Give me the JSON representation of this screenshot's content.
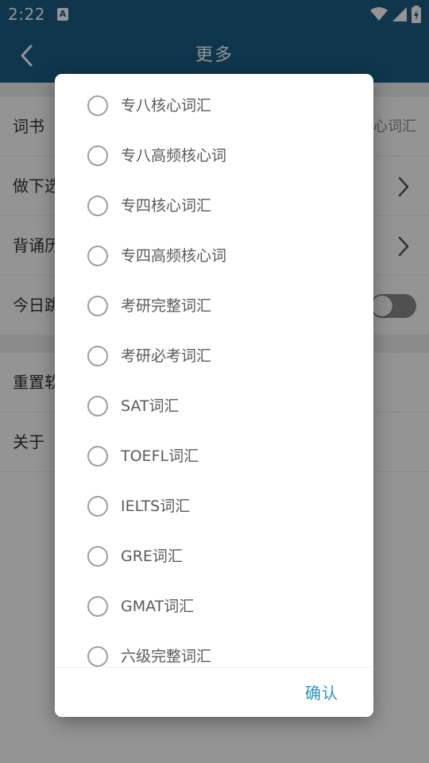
{
  "status_bar": {
    "time": "2:22",
    "left_icon": "A",
    "icons": [
      "wifi-icon",
      "cell-signal-icon",
      "battery-charging-icon"
    ]
  },
  "app_bar": {
    "title": "更多",
    "back_icon": "chevron-left-icon"
  },
  "settings": {
    "rows": [
      {
        "label": "词书",
        "value": "心词汇"
      },
      {
        "label": "做下选",
        "control": "chevron"
      },
      {
        "label": "背诵历",
        "control": "chevron"
      },
      {
        "label": "今日跳",
        "control": "toggle",
        "toggle_on": false
      }
    ],
    "rows2": [
      {
        "label": "重置软"
      },
      {
        "label": "关于"
      }
    ]
  },
  "dialog": {
    "options": [
      {
        "label": "专八核心词汇",
        "selected": false
      },
      {
        "label": "专八高频核心词",
        "selected": false
      },
      {
        "label": "专四核心词汇",
        "selected": false
      },
      {
        "label": "专四高频核心词",
        "selected": false
      },
      {
        "label": "考研完整词汇",
        "selected": false
      },
      {
        "label": "考研必考词汇",
        "selected": false
      },
      {
        "label": "SAT词汇",
        "selected": false
      },
      {
        "label": "TOEFL词汇",
        "selected": false
      },
      {
        "label": "IELTS词汇",
        "selected": false
      },
      {
        "label": "GRE词汇",
        "selected": false
      },
      {
        "label": "GMAT词汇",
        "selected": false
      },
      {
        "label": "六级完整词汇",
        "selected": false
      }
    ],
    "confirm_label": "确认"
  },
  "colors": {
    "app_bar": "#1b5e86",
    "accent": "#2a93c8",
    "radio_border": "#9e9e9e"
  }
}
